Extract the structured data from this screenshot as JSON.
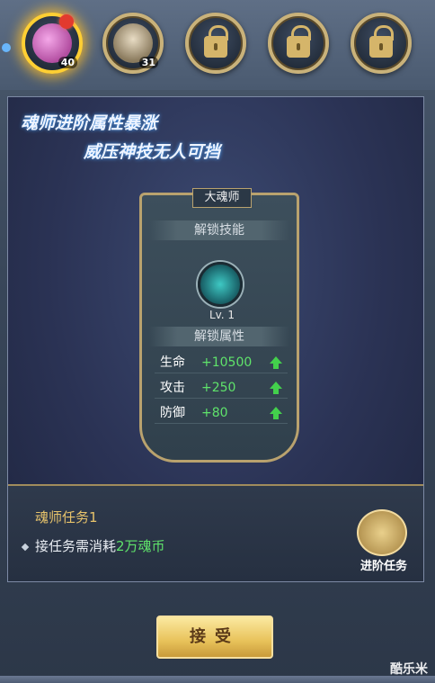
{
  "avatars": [
    {
      "name": "pink-creature-avatar",
      "level": "40",
      "active": true
    },
    {
      "name": "tiger-beast-avatar",
      "level": "31",
      "active": false
    },
    {
      "name": "locked-slot-1",
      "locked": true
    },
    {
      "name": "locked-slot-2",
      "locked": true
    },
    {
      "name": "locked-slot-3",
      "locked": true
    }
  ],
  "banner": {
    "line1": "魂师进阶属性暴涨",
    "line2": "威压神技无人可挡"
  },
  "card": {
    "rank": "大魂师",
    "unlock_skill_label": "解锁技能",
    "skill_level": "Lv. 1",
    "unlock_attr_label": "解锁属性",
    "stats": [
      {
        "name": "生命",
        "value": "+10500"
      },
      {
        "name": "攻击",
        "value": "+250"
      },
      {
        "name": "防御",
        "value": "+80"
      }
    ]
  },
  "task": {
    "title": "魂师任务1",
    "desc_prefix": "接任务需消耗",
    "desc_highlight": "2万魂币",
    "advance_label": "进阶任务"
  },
  "accept_label": "接受",
  "watermark": "酷乐米"
}
